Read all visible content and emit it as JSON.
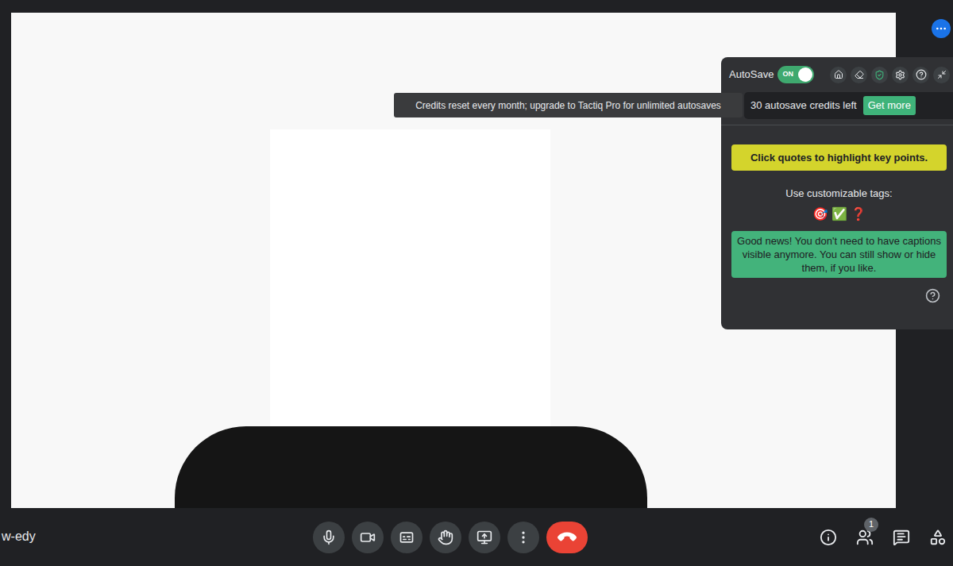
{
  "meeting": {
    "code": "w-edy"
  },
  "tactiq": {
    "autosave": {
      "label": "AutoSave",
      "toggle_text": "ON",
      "on": true
    },
    "tooltip": "Credits reset every month; upgrade to Tactiq Pro for unlimited autosaves",
    "credits": "30 autosave credits left",
    "get_more": "Get more",
    "tip": "Click quotes to highlight key points.",
    "tags_label": "Use customizable tags:",
    "tags": [
      {
        "symbol": "🎯",
        "color": "#e53935"
      },
      {
        "symbol": "✅",
        "color": "#43a047"
      },
      {
        "symbol": "❓",
        "color": "#e53935"
      }
    ],
    "notice": "Good news! You don't need to have captions visible anymore. You can still show or hide them, if you like."
  },
  "participants": {
    "count": "1"
  }
}
